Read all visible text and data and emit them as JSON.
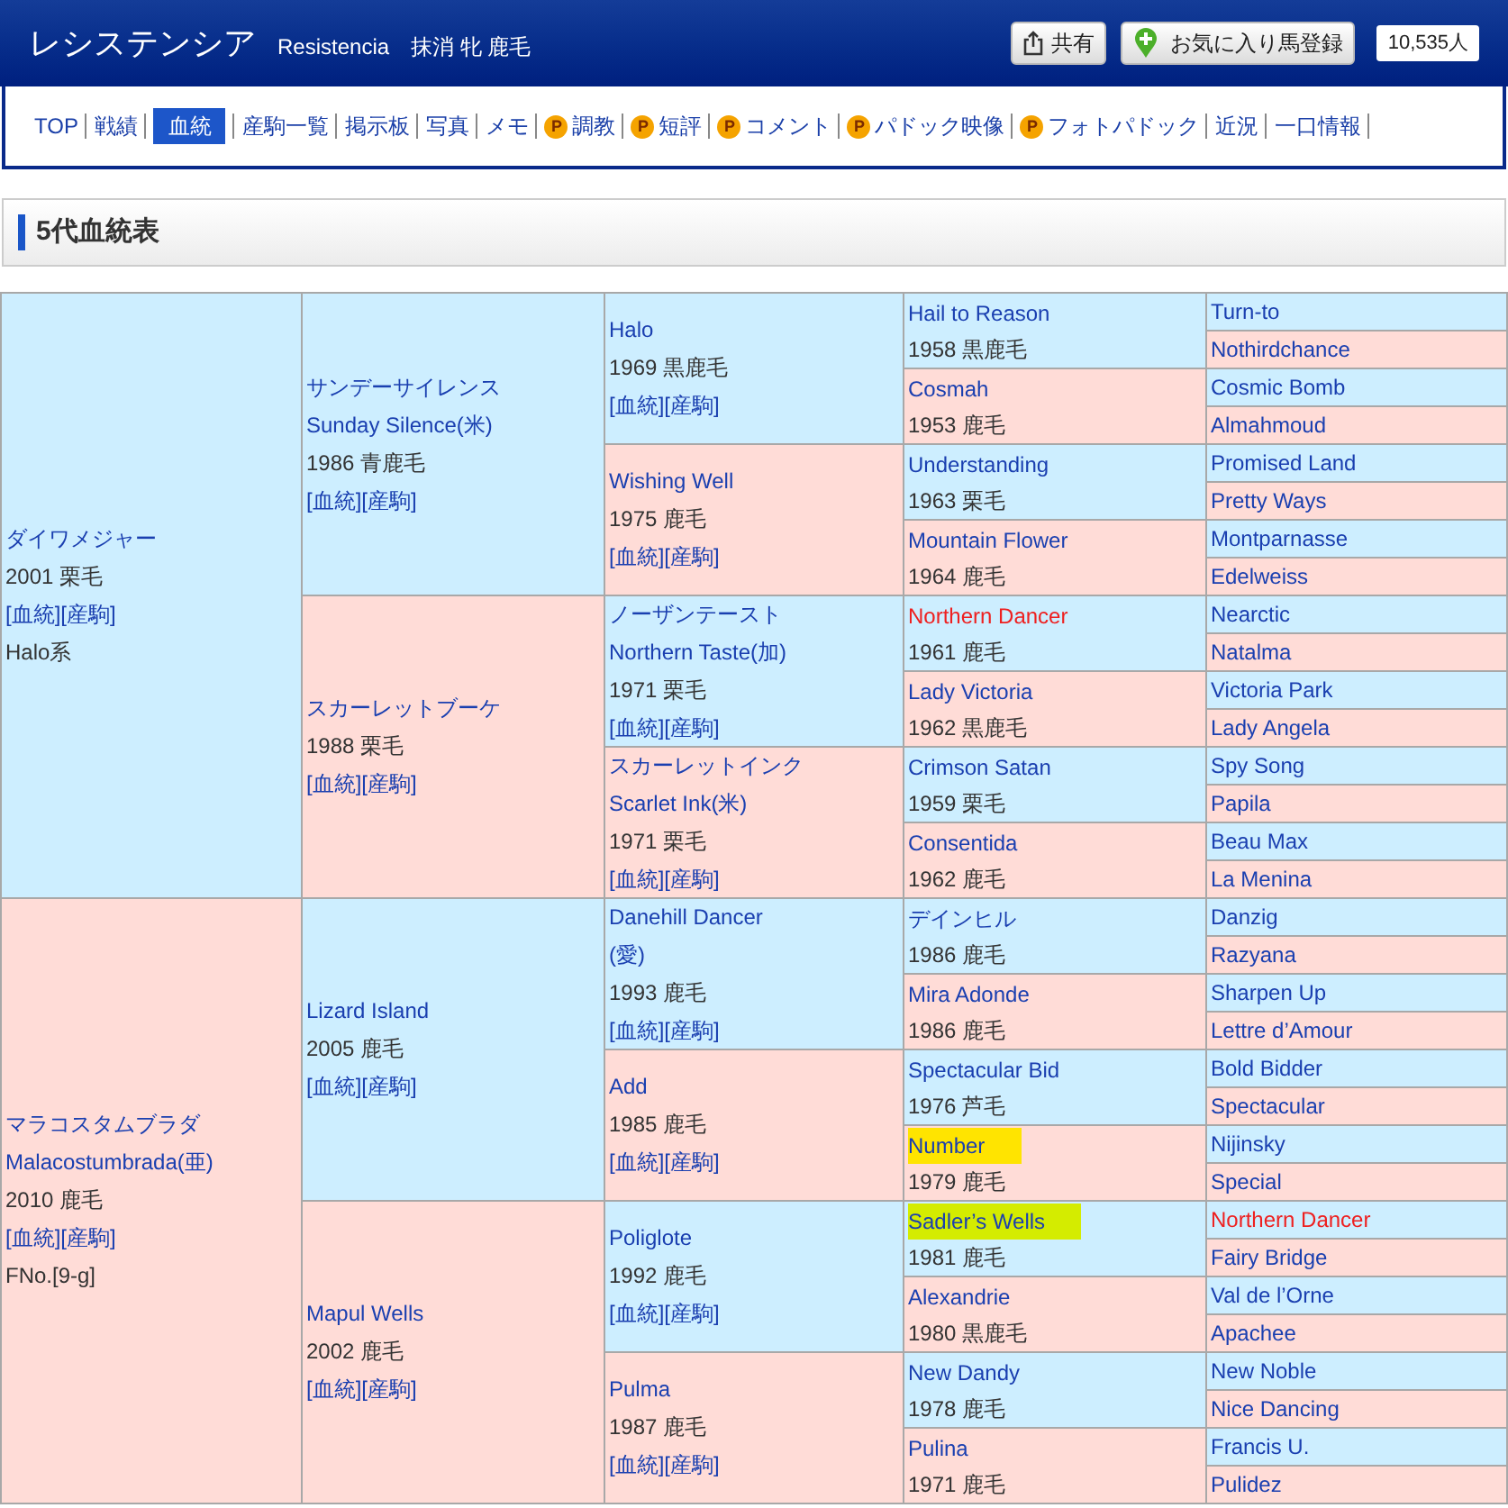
{
  "header": {
    "title": "レシステンシア",
    "subtitle": "Resistencia　抹消 牝 鹿毛",
    "share_button": "共有",
    "favorite_button": "お気に入り馬登録",
    "favorite_count": "10,535人"
  },
  "nav": [
    {
      "label": "TOP",
      "selected": false
    },
    {
      "label": "戦績",
      "selected": false
    },
    {
      "label": "血統",
      "selected": true
    },
    {
      "label": "産駒一覧",
      "selected": false
    },
    {
      "label": "掲示板",
      "selected": false
    },
    {
      "label": "写真",
      "selected": false
    },
    {
      "label": "メモ",
      "selected": false
    },
    {
      "label": "調教",
      "badge": "P",
      "selected": false
    },
    {
      "label": "短評",
      "badge": "P",
      "selected": false
    },
    {
      "label": "コメント",
      "badge": "P",
      "selected": false
    },
    {
      "label": "パドック映像",
      "badge": "P",
      "selected": false
    },
    {
      "label": "フォトパドック",
      "badge": "P",
      "selected": false
    },
    {
      "label": "近況",
      "selected": false
    },
    {
      "label": "一口情報",
      "selected": false
    }
  ],
  "section_title": "5代血統表",
  "pedigree": [
    {
      "name": "ダイワメジャー",
      "info": "2001 栗毛",
      "links": "[血統][産駒]",
      "extra": "Halo系",
      "inbred": false,
      "children": [
        {
          "name": "サンデーサイレンス",
          "name_en": "Sunday Silence(米)",
          "info": "1986 青鹿毛",
          "links": "[血統][産駒]",
          "inbred": false,
          "children": [
            {
              "name": "Halo",
              "info": "1969 黒鹿毛",
              "links": "[血統][産駒]",
              "inbred": false,
              "children": [
                {
                  "name": "Hail to Reason",
                  "info": "1958 黒鹿毛",
                  "inbred": false,
                  "children": [
                    {
                      "name": "Turn-to",
                      "inbred": false
                    },
                    {
                      "name": "Nothirdchance",
                      "inbred": false
                    }
                  ]
                },
                {
                  "name": "Cosmah",
                  "info": "1953 鹿毛",
                  "inbred": false,
                  "children": [
                    {
                      "name": "Cosmic Bomb",
                      "inbred": false
                    },
                    {
                      "name": "Almahmoud",
                      "inbred": false
                    }
                  ]
                }
              ]
            },
            {
              "name": "Wishing Well",
              "info": "1975 鹿毛",
              "links": "[血統][産駒]",
              "inbred": false,
              "children": [
                {
                  "name": "Understanding",
                  "info": "1963 栗毛",
                  "inbred": false,
                  "children": [
                    {
                      "name": "Promised Land",
                      "inbred": false
                    },
                    {
                      "name": "Pretty Ways",
                      "inbred": false
                    }
                  ]
                },
                {
                  "name": "Mountain Flower",
                  "info": "1964 鹿毛",
                  "inbred": false,
                  "children": [
                    {
                      "name": "Montparnasse",
                      "inbred": false
                    },
                    {
                      "name": "Edelweiss",
                      "inbred": false
                    }
                  ]
                }
              ]
            }
          ]
        },
        {
          "name": "スカーレットブーケ",
          "info": "1988 栗毛",
          "links": "[血統][産駒]",
          "inbred": false,
          "children": [
            {
              "name": "ノーザンテースト",
              "name_en": "Northern Taste(加)",
              "info": "1971 栗毛",
              "links": "[血統][産駒]",
              "inbred": false,
              "children": [
                {
                  "name": "Northern Dancer",
                  "info": "1961 鹿毛",
                  "inbred": true,
                  "children": [
                    {
                      "name": "Nearctic",
                      "inbred": false
                    },
                    {
                      "name": "Natalma",
                      "inbred": false
                    }
                  ]
                },
                {
                  "name": "Lady Victoria",
                  "info": "1962 黒鹿毛",
                  "inbred": false,
                  "children": [
                    {
                      "name": "Victoria Park",
                      "inbred": false
                    },
                    {
                      "name": "Lady Angela",
                      "inbred": false
                    }
                  ]
                }
              ]
            },
            {
              "name": "スカーレットインク",
              "name_en": "Scarlet Ink(米)",
              "info": "1971 栗毛",
              "links": "[血統][産駒]",
              "inbred": false,
              "children": [
                {
                  "name": "Crimson Satan",
                  "info": "1959 栗毛",
                  "inbred": false,
                  "children": [
                    {
                      "name": "Spy Song",
                      "inbred": false
                    },
                    {
                      "name": "Papila",
                      "inbred": false
                    }
                  ]
                },
                {
                  "name": "Consentida",
                  "info": "1962 鹿毛",
                  "inbred": false,
                  "children": [
                    {
                      "name": "Beau Max",
                      "inbred": false
                    },
                    {
                      "name": "La Menina",
                      "inbred": false
                    }
                  ]
                }
              ]
            }
          ]
        }
      ]
    },
    {
      "name": "マラコスタムブラダ",
      "name_en": "Malacostumbrada(亜)",
      "info": "2010 鹿毛",
      "links": "[血統][産駒]",
      "extra": "FNo.[9-g]",
      "inbred": false,
      "children": [
        {
          "name": "Lizard Island",
          "info": "2005 鹿毛",
          "links": "[血統][産駒]",
          "inbred": false,
          "children": [
            {
              "name": "Danehill Dancer",
              "name_en": "(愛)",
              "info": "1993 鹿毛",
              "links": "[血統][産駒]",
              "inbred": false,
              "children": [
                {
                  "name": "デインヒル",
                  "info": "1986 鹿毛",
                  "inbred": false,
                  "children": [
                    {
                      "name": "Danzig",
                      "inbred": false
                    },
                    {
                      "name": "Razyana",
                      "inbred": false
                    }
                  ]
                },
                {
                  "name": "Mira Adonde",
                  "info": "1986 鹿毛",
                  "inbred": false,
                  "children": [
                    {
                      "name": "Sharpen Up",
                      "inbred": false
                    },
                    {
                      "name": "Lettre d’Amour",
                      "inbred": false
                    }
                  ]
                }
              ]
            },
            {
              "name": "Add",
              "info": "1985 鹿毛",
              "links": "[血統][産駒]",
              "inbred": false,
              "children": [
                {
                  "name": "Spectacular Bid",
                  "info": "1976 芦毛",
                  "inbred": false,
                  "children": [
                    {
                      "name": "Bold Bidder",
                      "inbred": false
                    },
                    {
                      "name": "Spectacular",
                      "inbred": false
                    }
                  ]
                },
                {
                  "name": "Number",
                  "info": "1979 鹿毛",
                  "inbred": false,
                  "color": "#ffe400",
                  "children": [
                    {
                      "name": "Nijinsky",
                      "inbred": false
                    },
                    {
                      "name": "Special",
                      "inbred": false
                    }
                  ]
                }
              ]
            }
          ]
        },
        {
          "name": "Mapul Wells",
          "info": "2002 鹿毛",
          "links": "[血統][産駒]",
          "inbred": false,
          "children": [
            {
              "name": "Poliglote",
              "info": "1992 鹿毛",
              "links": "[血統][産駒]",
              "inbred": false,
              "children": [
                {
                  "name": "Sadler’s Wells",
                  "info": "1981 鹿毛",
                  "inbred": false,
                  "color": "#d4ec00",
                  "children": [
                    {
                      "name": "Northern Dancer",
                      "inbred": true
                    },
                    {
                      "name": "Fairy Bridge",
                      "inbred": false
                    }
                  ]
                },
                {
                  "name": "Alexandrie",
                  "info": "1980 黒鹿毛",
                  "inbred": false,
                  "children": [
                    {
                      "name": "Val de l’Orne",
                      "inbred": false
                    },
                    {
                      "name": "Apachee",
                      "inbred": false
                    }
                  ]
                }
              ]
            },
            {
              "name": "Pulma",
              "info": "1987 鹿毛",
              "links": "[血統][産駒]",
              "inbred": false,
              "children": [
                {
                  "name": "New Dandy",
                  "info": "1978 鹿毛",
                  "inbred": false,
                  "children": [
                    {
                      "name": "New Noble",
                      "inbred": false
                    },
                    {
                      "name": "Nice Dancing",
                      "inbred": false
                    }
                  ]
                },
                {
                  "name": "Pulina",
                  "info": "1971 鹿毛",
                  "inbred": false,
                  "children": [
                    {
                      "name": "Francis U.",
                      "inbred": false
                    },
                    {
                      "name": "Pulidez",
                      "inbred": false
                    }
                  ]
                }
              ]
            }
          ]
        }
      ]
    }
  ]
}
